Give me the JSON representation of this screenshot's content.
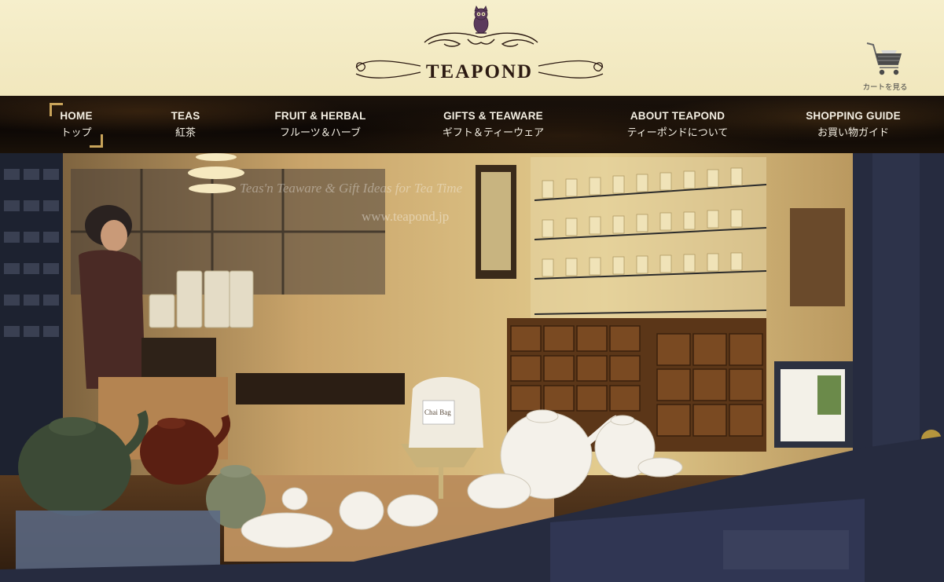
{
  "brand": {
    "name": "TEAPOND"
  },
  "cart": {
    "label": "カートを見る",
    "icon": "cart-icon"
  },
  "nav": {
    "items": [
      {
        "en": "HOME",
        "ja": "トップ",
        "active": true
      },
      {
        "en": "TEAS",
        "ja": "紅茶"
      },
      {
        "en": "FRUIT & HERBAL",
        "ja": "フルーツ＆ハーブ"
      },
      {
        "en": "GIFTS & TEAWARE",
        "ja": "ギフト＆ティーウェア"
      },
      {
        "en": "ABOUT TEAPOND",
        "ja": "ティーポンドについて"
      },
      {
        "en": "SHOPPING GUIDE",
        "ja": "お買い物ガイド"
      }
    ]
  },
  "hero": {
    "window_text": "Teas'n Teaware & Gift Ideas for Tea Time",
    "window_url": "www.teapond.jp",
    "tea_bag_label": "Chai Bag"
  },
  "colors": {
    "header_bg": "#f4ecc4",
    "nav_bg": "#120c07",
    "accent_gold": "#c9a45a",
    "nav_text": "#f3eee2"
  }
}
